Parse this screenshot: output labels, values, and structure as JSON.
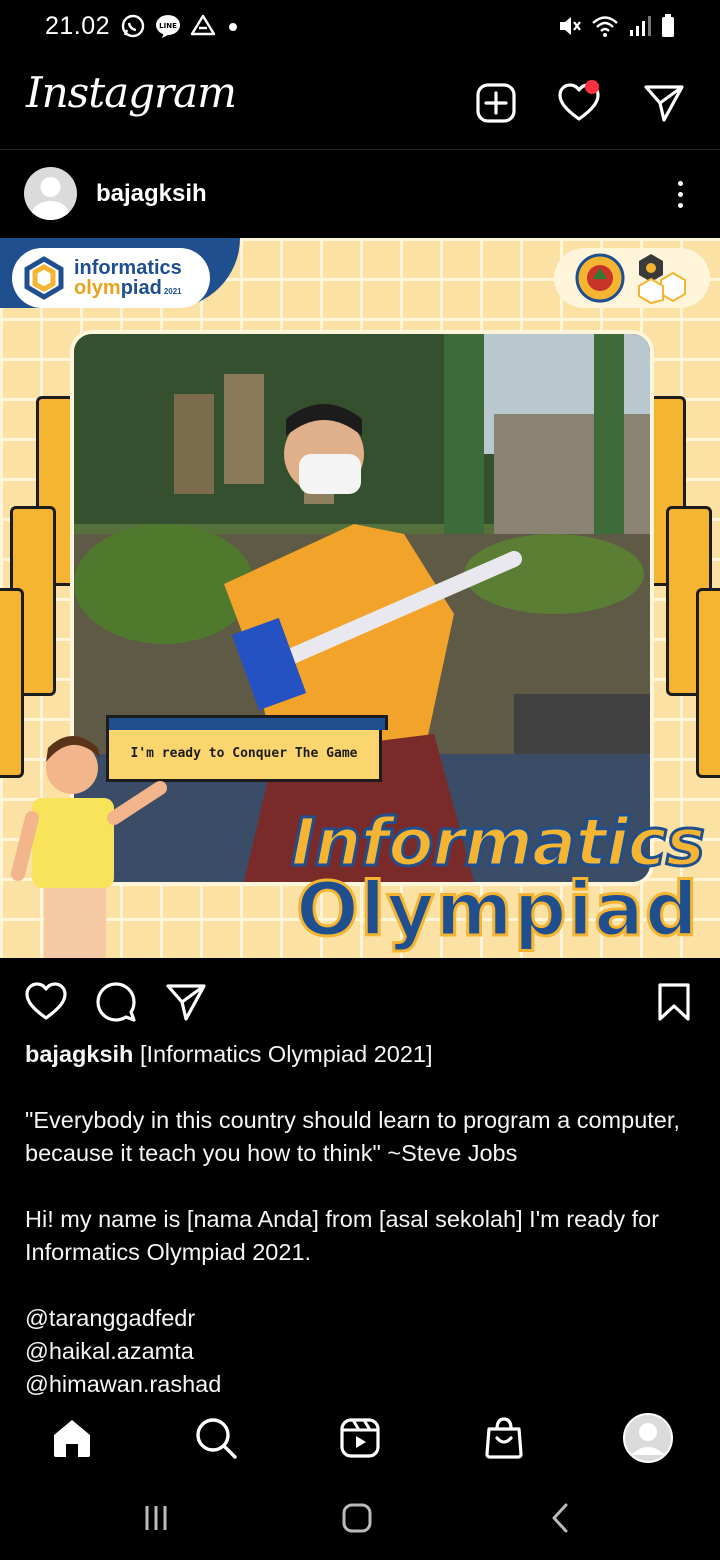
{
  "status_bar": {
    "time": "21.02",
    "left_icons": [
      "whatsapp-icon",
      "line-icon",
      "drive-icon",
      "dot-icon"
    ],
    "right_icons": [
      "mute-icon",
      "wifi-icon",
      "signal-icon",
      "battery-icon"
    ]
  },
  "header": {
    "logo_text": "Instagram",
    "icons": [
      "new-post-icon",
      "heart-icon",
      "direct-icon"
    ],
    "notification_dot_color": "#ff3040"
  },
  "post": {
    "username": "bajagksih",
    "image": {
      "logo_line1": "informatics",
      "logo_line2_a": "olym",
      "logo_line2_b": "piad",
      "logo_year": "2021",
      "ready_text": "I'm ready to Conquer The Game",
      "title_line1": "Informatics",
      "title_line2": "Olympiad",
      "colors": {
        "yellow": "#f5b533",
        "blue": "#1f4f8f",
        "background": "#fbe2a4"
      }
    },
    "caption": {
      "username": "bajagksih",
      "title": "[Informatics Olympiad 2021]",
      "quote_line1": "\"Everybody in this country should learn to program a computer,",
      "quote_line2": "because it teach you how to think\" ~Steve Jobs",
      "intro_line1": "Hi! my name is [nama Anda] from [asal sekolah] I'm ready for",
      "intro_line2": "Informatics Olympiad 2021.",
      "mentions": [
        "@taranggadfedr",
        "@haikal.azamta",
        "@himawan.rashad"
      ]
    }
  },
  "bottom_nav": {
    "items": [
      "home-icon",
      "search-icon",
      "reels-icon",
      "shop-icon",
      "profile-icon"
    ]
  },
  "system_nav": {
    "items": [
      "recents-icon",
      "home-button-icon",
      "back-icon"
    ]
  }
}
